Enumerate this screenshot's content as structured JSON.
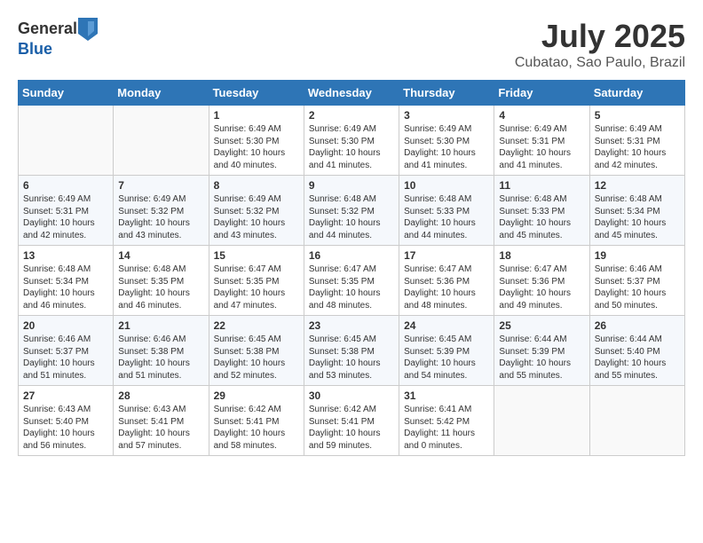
{
  "header": {
    "logo_line1": "General",
    "logo_line2": "Blue",
    "month": "July 2025",
    "location": "Cubatao, Sao Paulo, Brazil"
  },
  "weekdays": [
    "Sunday",
    "Monday",
    "Tuesday",
    "Wednesday",
    "Thursday",
    "Friday",
    "Saturday"
  ],
  "weeks": [
    [
      {
        "day": "",
        "info": ""
      },
      {
        "day": "",
        "info": ""
      },
      {
        "day": "1",
        "info": "Sunrise: 6:49 AM\nSunset: 5:30 PM\nDaylight: 10 hours\nand 40 minutes."
      },
      {
        "day": "2",
        "info": "Sunrise: 6:49 AM\nSunset: 5:30 PM\nDaylight: 10 hours\nand 41 minutes."
      },
      {
        "day": "3",
        "info": "Sunrise: 6:49 AM\nSunset: 5:30 PM\nDaylight: 10 hours\nand 41 minutes."
      },
      {
        "day": "4",
        "info": "Sunrise: 6:49 AM\nSunset: 5:31 PM\nDaylight: 10 hours\nand 41 minutes."
      },
      {
        "day": "5",
        "info": "Sunrise: 6:49 AM\nSunset: 5:31 PM\nDaylight: 10 hours\nand 42 minutes."
      }
    ],
    [
      {
        "day": "6",
        "info": "Sunrise: 6:49 AM\nSunset: 5:31 PM\nDaylight: 10 hours\nand 42 minutes."
      },
      {
        "day": "7",
        "info": "Sunrise: 6:49 AM\nSunset: 5:32 PM\nDaylight: 10 hours\nand 43 minutes."
      },
      {
        "day": "8",
        "info": "Sunrise: 6:49 AM\nSunset: 5:32 PM\nDaylight: 10 hours\nand 43 minutes."
      },
      {
        "day": "9",
        "info": "Sunrise: 6:48 AM\nSunset: 5:32 PM\nDaylight: 10 hours\nand 44 minutes."
      },
      {
        "day": "10",
        "info": "Sunrise: 6:48 AM\nSunset: 5:33 PM\nDaylight: 10 hours\nand 44 minutes."
      },
      {
        "day": "11",
        "info": "Sunrise: 6:48 AM\nSunset: 5:33 PM\nDaylight: 10 hours\nand 45 minutes."
      },
      {
        "day": "12",
        "info": "Sunrise: 6:48 AM\nSunset: 5:34 PM\nDaylight: 10 hours\nand 45 minutes."
      }
    ],
    [
      {
        "day": "13",
        "info": "Sunrise: 6:48 AM\nSunset: 5:34 PM\nDaylight: 10 hours\nand 46 minutes."
      },
      {
        "day": "14",
        "info": "Sunrise: 6:48 AM\nSunset: 5:35 PM\nDaylight: 10 hours\nand 46 minutes."
      },
      {
        "day": "15",
        "info": "Sunrise: 6:47 AM\nSunset: 5:35 PM\nDaylight: 10 hours\nand 47 minutes."
      },
      {
        "day": "16",
        "info": "Sunrise: 6:47 AM\nSunset: 5:35 PM\nDaylight: 10 hours\nand 48 minutes."
      },
      {
        "day": "17",
        "info": "Sunrise: 6:47 AM\nSunset: 5:36 PM\nDaylight: 10 hours\nand 48 minutes."
      },
      {
        "day": "18",
        "info": "Sunrise: 6:47 AM\nSunset: 5:36 PM\nDaylight: 10 hours\nand 49 minutes."
      },
      {
        "day": "19",
        "info": "Sunrise: 6:46 AM\nSunset: 5:37 PM\nDaylight: 10 hours\nand 50 minutes."
      }
    ],
    [
      {
        "day": "20",
        "info": "Sunrise: 6:46 AM\nSunset: 5:37 PM\nDaylight: 10 hours\nand 51 minutes."
      },
      {
        "day": "21",
        "info": "Sunrise: 6:46 AM\nSunset: 5:38 PM\nDaylight: 10 hours\nand 51 minutes."
      },
      {
        "day": "22",
        "info": "Sunrise: 6:45 AM\nSunset: 5:38 PM\nDaylight: 10 hours\nand 52 minutes."
      },
      {
        "day": "23",
        "info": "Sunrise: 6:45 AM\nSunset: 5:38 PM\nDaylight: 10 hours\nand 53 minutes."
      },
      {
        "day": "24",
        "info": "Sunrise: 6:45 AM\nSunset: 5:39 PM\nDaylight: 10 hours\nand 54 minutes."
      },
      {
        "day": "25",
        "info": "Sunrise: 6:44 AM\nSunset: 5:39 PM\nDaylight: 10 hours\nand 55 minutes."
      },
      {
        "day": "26",
        "info": "Sunrise: 6:44 AM\nSunset: 5:40 PM\nDaylight: 10 hours\nand 55 minutes."
      }
    ],
    [
      {
        "day": "27",
        "info": "Sunrise: 6:43 AM\nSunset: 5:40 PM\nDaylight: 10 hours\nand 56 minutes."
      },
      {
        "day": "28",
        "info": "Sunrise: 6:43 AM\nSunset: 5:41 PM\nDaylight: 10 hours\nand 57 minutes."
      },
      {
        "day": "29",
        "info": "Sunrise: 6:42 AM\nSunset: 5:41 PM\nDaylight: 10 hours\nand 58 minutes."
      },
      {
        "day": "30",
        "info": "Sunrise: 6:42 AM\nSunset: 5:41 PM\nDaylight: 10 hours\nand 59 minutes."
      },
      {
        "day": "31",
        "info": "Sunrise: 6:41 AM\nSunset: 5:42 PM\nDaylight: 11 hours\nand 0 minutes."
      },
      {
        "day": "",
        "info": ""
      },
      {
        "day": "",
        "info": ""
      }
    ]
  ]
}
